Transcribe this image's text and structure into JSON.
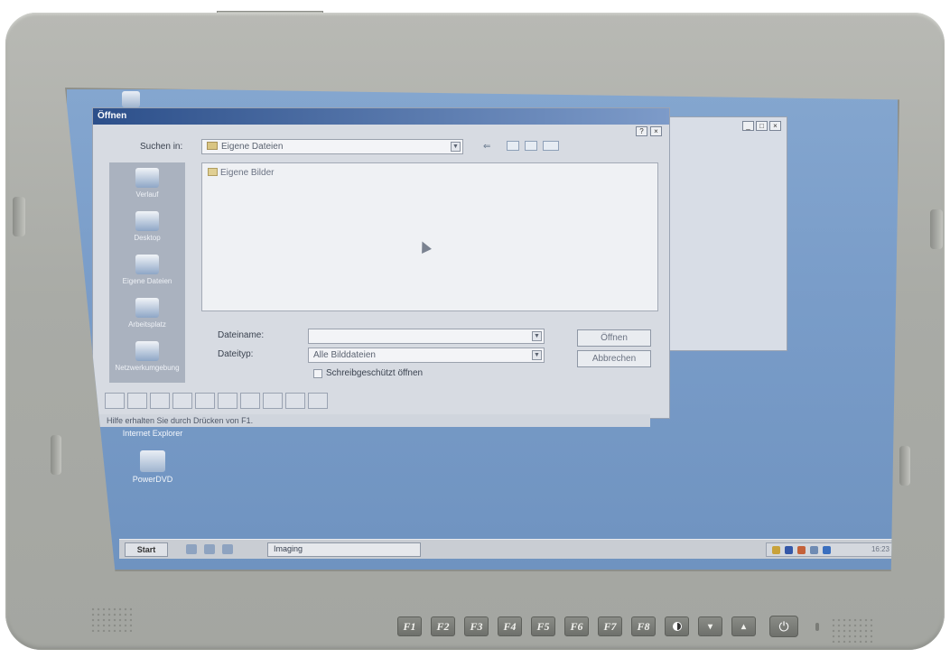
{
  "dialog": {
    "title": "Öffnen",
    "title_controls": [
      "?",
      "×"
    ],
    "look_in_label": "Suchen in:",
    "look_in_value": "Eigene Dateien",
    "places": [
      "Verlauf",
      "Desktop",
      "Eigene Dateien",
      "Arbeitsplatz",
      "Netzwerkumgebung"
    ],
    "files": [
      "Eigene Bilder"
    ],
    "filename_label": "Dateiname:",
    "filename_value": "",
    "filetype_label": "Dateityp:",
    "filetype_value": "Alle Bilddateien",
    "readonly_label": "Schreibgeschützt öffnen",
    "open_button": "Öffnen",
    "cancel_button": "Abbrechen"
  },
  "background_window": {
    "controls": [
      "_",
      "□",
      "×"
    ]
  },
  "statusbar": {
    "text": "Hilfe erhalten Sie durch Drücken von F1."
  },
  "desktop": {
    "icons": [
      "Internet Explorer",
      "PowerDVD"
    ]
  },
  "taskbar": {
    "start_label": "Start",
    "task_label": "Imaging",
    "clock": "16:23"
  },
  "monitor": {
    "function_keys": [
      "F1",
      "F2",
      "F3",
      "F4",
      "F5",
      "F6",
      "F7",
      "F8"
    ],
    "power_symbol": "⏻"
  },
  "colors": {
    "desktop": "#7a9dc9",
    "bezel": "#a9aba6",
    "titlebar": "#2c4f8a"
  }
}
